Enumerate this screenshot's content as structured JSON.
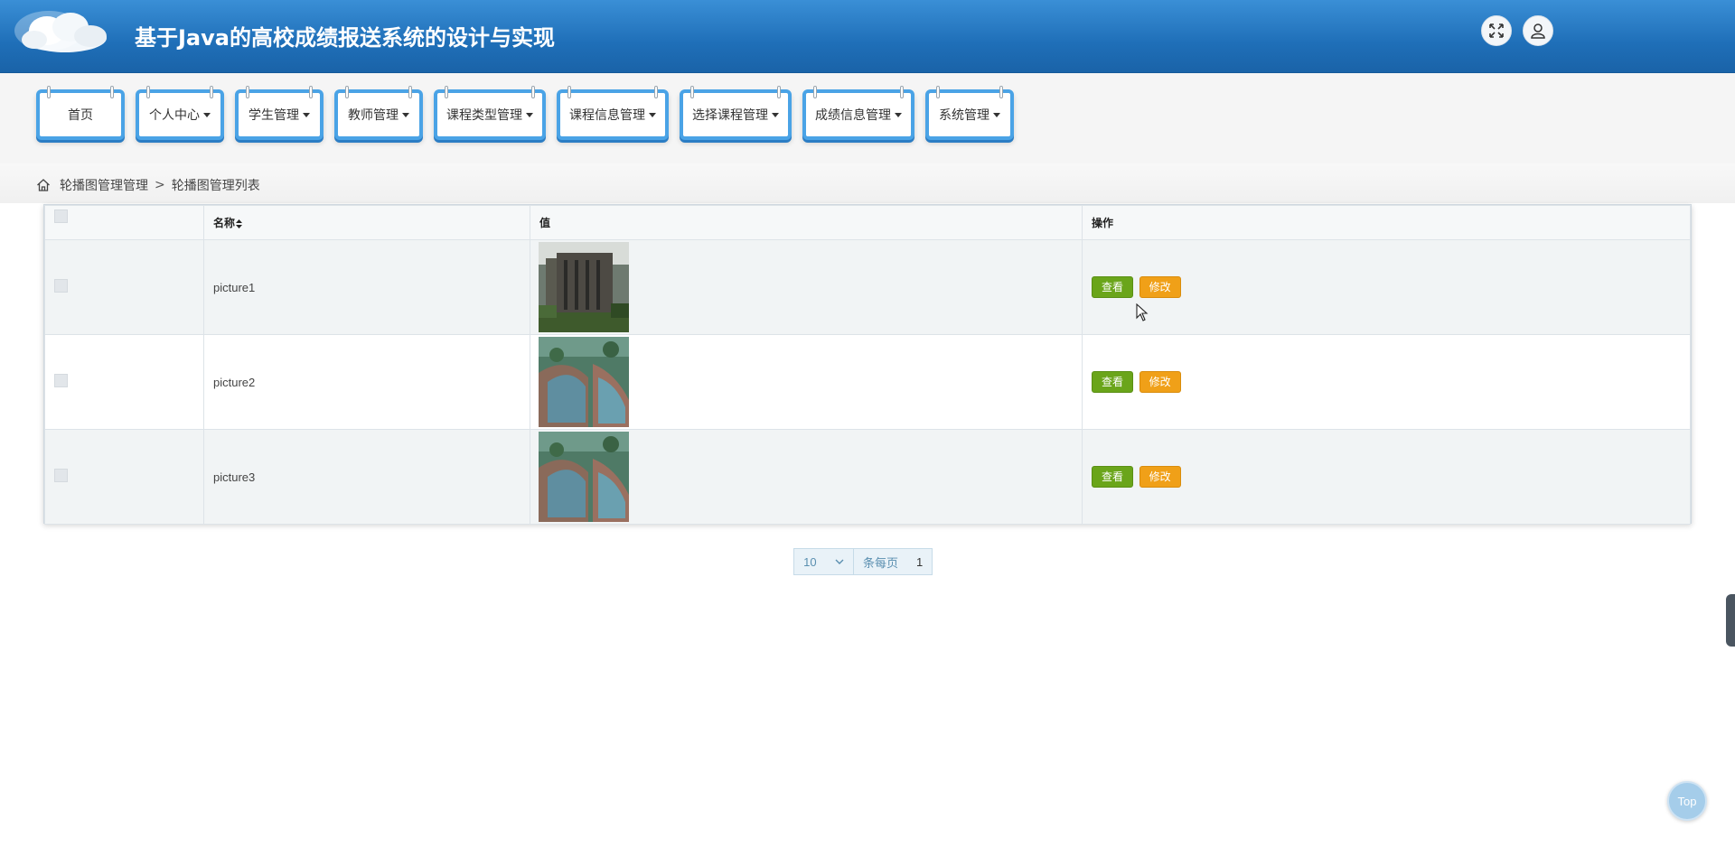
{
  "header": {
    "title": "基于Java的高校成绩报送系统的设计与实现"
  },
  "nav": [
    {
      "label": "首页",
      "dropdown": false
    },
    {
      "label": "个人中心",
      "dropdown": true
    },
    {
      "label": "学生管理",
      "dropdown": true
    },
    {
      "label": "教师管理",
      "dropdown": true
    },
    {
      "label": "课程类型管理",
      "dropdown": true
    },
    {
      "label": "课程信息管理",
      "dropdown": true
    },
    {
      "label": "选择课程管理",
      "dropdown": true
    },
    {
      "label": "成绩信息管理",
      "dropdown": true
    },
    {
      "label": "系统管理",
      "dropdown": true
    }
  ],
  "breadcrumb": {
    "parent": "轮播图管理管理",
    "separator": ">",
    "current": "轮播图管理列表"
  },
  "table": {
    "columns": {
      "name": "名称",
      "value": "值",
      "actions": "操作"
    },
    "rows": [
      {
        "name": "picture1"
      },
      {
        "name": "picture2"
      },
      {
        "name": "picture3"
      }
    ],
    "view_label": "查看",
    "edit_label": "修改"
  },
  "pagination": {
    "page_size": "10",
    "per_page_text": "条每页",
    "page": "1"
  },
  "top_button": "Top",
  "colors": {
    "header": "#1f6fb8",
    "nav_border": "#4aa3e6",
    "view_btn": "#6aa51a",
    "edit_btn": "#f0a018"
  },
  "icons": [
    "cloud-logo-icon",
    "fullscreen-icon",
    "user-icon",
    "home-icon",
    "sort-icon",
    "chevron-down-icon"
  ]
}
